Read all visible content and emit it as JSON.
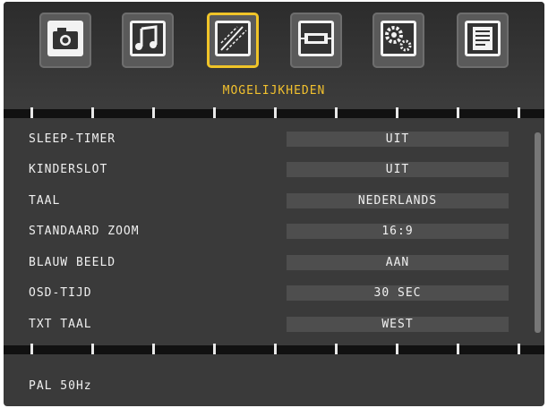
{
  "menu": {
    "title": "MOGELIJKHEDEN",
    "tabs": [
      {
        "icon": "camera-icon"
      },
      {
        "icon": "music-note-icon"
      },
      {
        "icon": "features-icon",
        "active": true
      },
      {
        "icon": "connector-icon"
      },
      {
        "icon": "settings-gears-icon"
      },
      {
        "icon": "document-icon"
      }
    ]
  },
  "settings": [
    {
      "label": "SLEEP-TIMER",
      "value": "UIT"
    },
    {
      "label": "KINDERSLOT",
      "value": "UIT"
    },
    {
      "label": "TAAL",
      "value": "NEDERLANDS"
    },
    {
      "label": "STANDAARD ZOOM",
      "value": "16:9"
    },
    {
      "label": "BLAUW BEELD",
      "value": "AAN"
    },
    {
      "label": "OSD-TIJD",
      "value": "30 SEC"
    },
    {
      "label": "TXT TAAL",
      "value": "WEST"
    }
  ],
  "footer": {
    "signal": "PAL 50Hz"
  },
  "colors": {
    "accent": "#f2c12e",
    "background": "#3a3a3a",
    "value_box": "#4e4e4e"
  }
}
